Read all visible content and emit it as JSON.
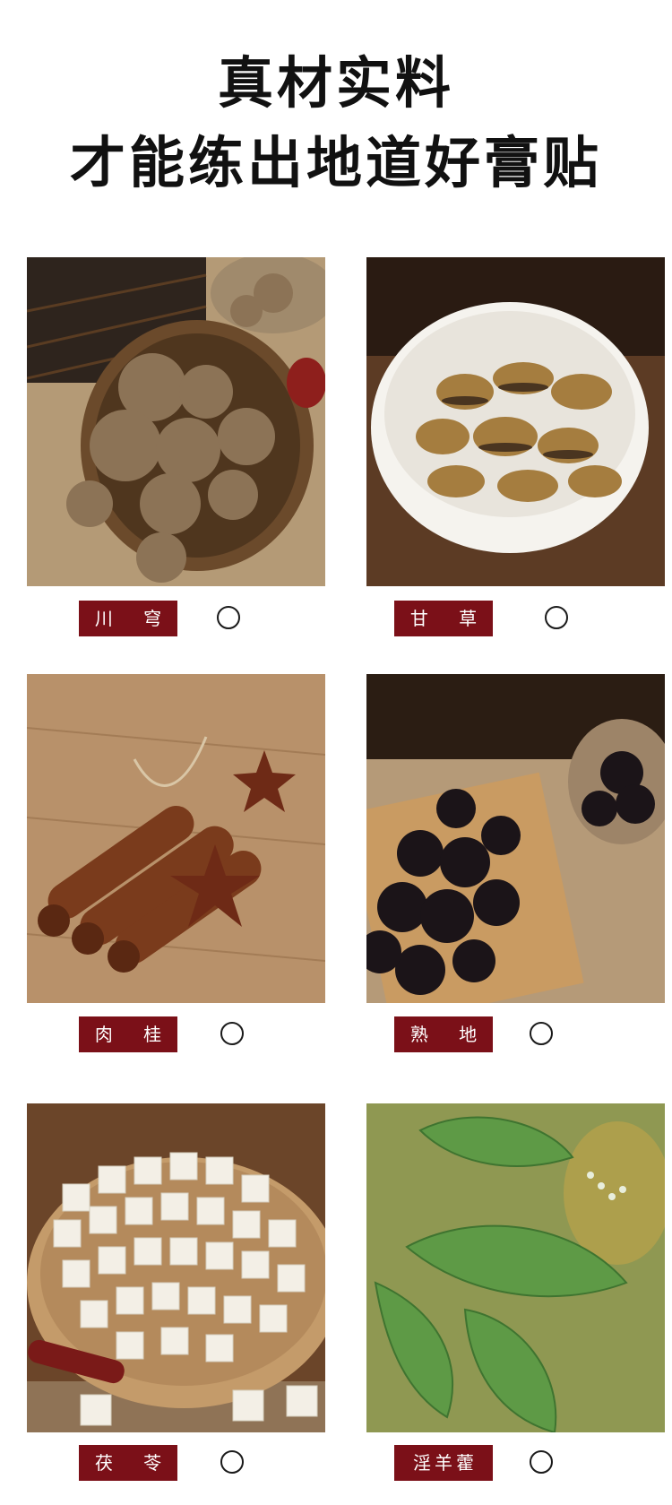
{
  "headline": {
    "line1": "真材实料",
    "line2": "才能练出地道好膏贴"
  },
  "herbs": [
    {
      "name": "川 穹",
      "checked": false
    },
    {
      "name": "甘 草",
      "checked": false
    },
    {
      "name": "肉 桂",
      "checked": false
    },
    {
      "name": "熟 地",
      "checked": false
    },
    {
      "name": "茯 苓",
      "checked": false
    },
    {
      "name": "淫羊藿",
      "checked": false
    }
  ],
  "colors": {
    "tag_bg": "#7b1018",
    "tag_text": "#ffffff",
    "headline": "#111111"
  }
}
